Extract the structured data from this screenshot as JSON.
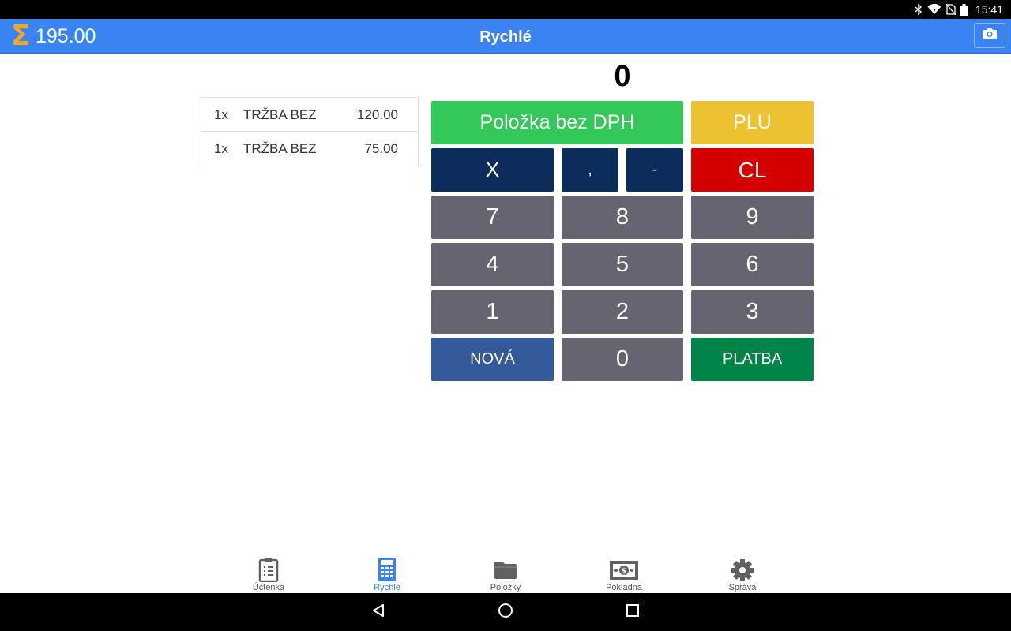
{
  "status_bar": {
    "time": "15:41",
    "icons": [
      "bluetooth-icon",
      "wifi-icon",
      "no-sim-icon",
      "battery-icon"
    ]
  },
  "app_bar": {
    "sigma_symbol": "Σ",
    "total": "195.00",
    "title": "Rychlé",
    "camera_icon": "camera-icon",
    "colors": {
      "background": "#3b83f0",
      "sigma": "#f5a623"
    }
  },
  "entry": {
    "value": "0"
  },
  "receipt": {
    "items": [
      {
        "qty": "1x",
        "name": "TRŽBA BEZ",
        "price": "120.00"
      },
      {
        "qty": "1x",
        "name": "TRŽBA BEZ",
        "price": "75.00"
      }
    ]
  },
  "keypad": {
    "item_without_vat": "Položka bez DPH",
    "plu": "PLU",
    "multiply": "X",
    "comma": ",",
    "minus": "-",
    "clear": "CL",
    "digits": {
      "d7": "7",
      "d8": "8",
      "d9": "9",
      "d4": "4",
      "d5": "5",
      "d6": "6",
      "d1": "1",
      "d2": "2",
      "d3": "3",
      "d0": "0"
    },
    "new": "NOVÁ",
    "pay": "PLATBA",
    "colors": {
      "green": "#34c759",
      "yellow": "#ecc232",
      "navy": "#0c2d5c",
      "red": "#d40000",
      "gray": "#666470",
      "blue": "#355a9c",
      "platba": "#008447"
    }
  },
  "bottom_nav": {
    "active": "Rychlé",
    "items": [
      {
        "label": "Účtenka",
        "icon": "receipt-clipboard-icon"
      },
      {
        "label": "Rychlé",
        "icon": "calculator-icon"
      },
      {
        "label": "Položky",
        "icon": "folder-icon"
      },
      {
        "label": "Pokladna",
        "icon": "cash-icon"
      },
      {
        "label": "Správa",
        "icon": "gear-icon"
      }
    ]
  },
  "system_nav": {
    "icons": [
      "back-icon",
      "home-icon",
      "recents-icon"
    ]
  }
}
